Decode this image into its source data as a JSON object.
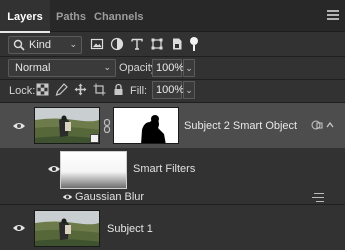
{
  "tabs": [
    {
      "label": "Layers",
      "active": true
    },
    {
      "label": "Paths",
      "active": false
    },
    {
      "label": "Channels",
      "active": false
    }
  ],
  "filter": {
    "kind_label": "Kind",
    "icons": [
      "pixel-layer-filter-icon",
      "adjustment-layer-filter-icon",
      "type-layer-filter-icon",
      "shape-layer-filter-icon",
      "smart-object-filter-icon"
    ]
  },
  "blend": {
    "mode": "Normal",
    "opacity_label": "Opacity:",
    "opacity_value": "100%"
  },
  "lock": {
    "label": "Lock:",
    "icons": [
      "lock-transparent-pixels-icon",
      "lock-image-pixels-icon",
      "lock-position-icon",
      "lock-artboard-icon",
      "lock-all-icon"
    ],
    "fill_label": "Fill:",
    "fill_value": "100%"
  },
  "layers": [
    {
      "name": "Subject 2 Smart Object",
      "selected": true,
      "visible": true
    },
    {
      "name": "Subject 1",
      "selected": false,
      "visible": true
    }
  ],
  "smart_filters": {
    "label": "Smart Filters",
    "filter_name": "Gaussian Blur"
  },
  "colors": {
    "panel_bg": "#323232",
    "selected_row": "#4d4d4d",
    "tab_bar": "#282828"
  }
}
